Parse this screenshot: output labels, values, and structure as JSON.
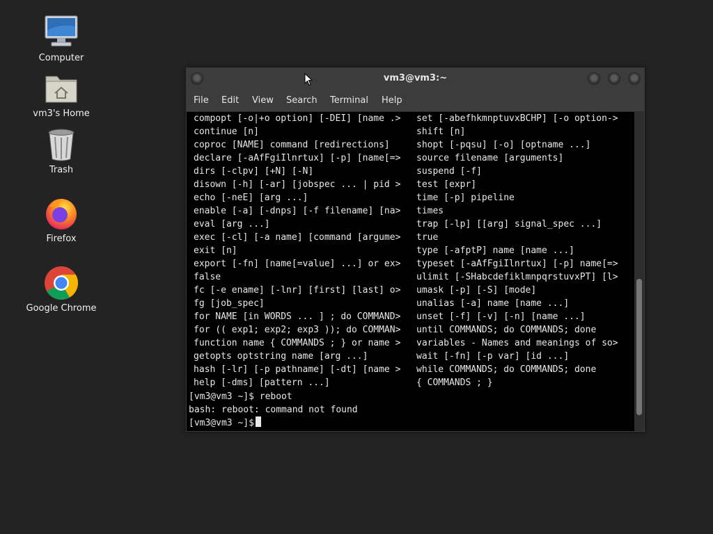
{
  "desktop": {
    "icons": [
      {
        "label": "Computer"
      },
      {
        "label": "vm3's Home"
      },
      {
        "label": "Trash"
      },
      {
        "label": "Firefox"
      },
      {
        "label": "Google Chrome"
      }
    ]
  },
  "window": {
    "title": "vm3@vm3:~",
    "menu": [
      "File",
      "Edit",
      "View",
      "Search",
      "Terminal",
      "Help"
    ]
  },
  "terminal": {
    "left_column": [
      "compopt [-o|+o option] [-DEI] [name .>",
      "continue [n]",
      "coproc [NAME] command [redirections]",
      "declare [-aAfFgiIlnrtux] [-p] [name[=>",
      "dirs [-clpv] [+N] [-N]",
      "disown [-h] [-ar] [jobspec ... | pid >",
      "echo [-neE] [arg ...]",
      "enable [-a] [-dnps] [-f filename] [na>",
      "eval [arg ...]",
      "exec [-cl] [-a name] [command [argume>",
      "exit [n]",
      "export [-fn] [name[=value] ...] or ex>",
      "false",
      "fc [-e ename] [-lnr] [first] [last] o>",
      "fg [job_spec]",
      "for NAME [in WORDS ... ] ; do COMMAND>",
      "for (( exp1; exp2; exp3 )); do COMMAN>",
      "function name { COMMANDS ; } or name >",
      "getopts optstring name [arg ...]",
      "hash [-lr] [-p pathname] [-dt] [name >",
      "help [-dms] [pattern ...]"
    ],
    "right_column": [
      "set [-abefhkmnptuvxBCHP] [-o option->",
      "shift [n]",
      "shopt [-pqsu] [-o] [optname ...]",
      "source filename [arguments]",
      "suspend [-f]",
      "test [expr]",
      "time [-p] pipeline",
      "times",
      "trap [-lp] [[arg] signal_spec ...]",
      "true",
      "type [-afptP] name [name ...]",
      "typeset [-aAfFgiIlnrtux] [-p] name[=>",
      "ulimit [-SHabcdefiklmnpqrstuvxPT] [l>",
      "umask [-p] [-S] [mode]",
      "unalias [-a] name [name ...]",
      "unset [-f] [-v] [-n] [name ...]",
      "until COMMANDS; do COMMANDS; done",
      "variables - Names and meanings of so>",
      "wait [-fn] [-p var] [id ...]",
      "while COMMANDS; do COMMANDS; done",
      "{ COMMANDS ; }"
    ],
    "line_prompt_1": "[vm3@vm3 ~]$ reboot",
    "line_error": "bash: reboot: command not found",
    "line_prompt_2": "[vm3@vm3 ~]$"
  }
}
